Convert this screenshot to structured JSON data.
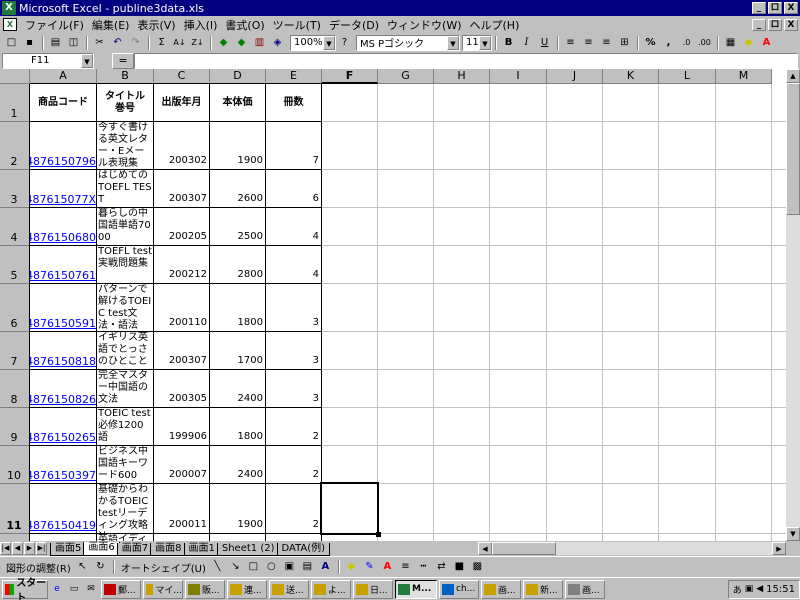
{
  "window": {
    "title": "Microsoft Excel - publine3data.xls",
    "app_icon": "excel-icon",
    "caption_buttons": [
      "_",
      "ロ",
      "X"
    ]
  },
  "menu": {
    "items": [
      "ファイル(F)",
      "編集(E)",
      "表示(V)",
      "挿入(I)",
      "書式(O)",
      "ツール(T)",
      "データ(D)",
      "ウィンドウ(W)",
      "ヘルプ(H)"
    ],
    "doc_buttons": [
      "_",
      "ロ",
      "X"
    ]
  },
  "toolbar": {
    "zoom": "100%",
    "font": "MS Pゴシック",
    "font_size": "11",
    "bold": "B",
    "italic": "I",
    "underline": "U",
    "percent": "%",
    "comma": ","
  },
  "formula_bar": {
    "name_box": "F11",
    "eq": "=",
    "value": ""
  },
  "grid": {
    "columns": [
      "A",
      "B",
      "C",
      "D",
      "E",
      "F",
      "G",
      "H",
      "I",
      "J",
      "K",
      "L",
      "M"
    ],
    "headers": {
      "A": "商品コード",
      "B": "タイトル 巻号",
      "C": "出版年月",
      "D": "本体価",
      "E": "冊数"
    },
    "rows": [
      {
        "n": "2",
        "code": "4876150796",
        "title": "今すぐ書ける英文レター・Eメール表現集",
        "date": "200302",
        "price": "1900",
        "qty": "7"
      },
      {
        "n": "3",
        "code": "487615077X",
        "title": "はじめてのTOEFL TEST",
        "date": "200307",
        "price": "2600",
        "qty": "6"
      },
      {
        "n": "4",
        "code": "4876150680",
        "title": "暮らしの中国語単語7000",
        "date": "200205",
        "price": "2500",
        "qty": "4"
      },
      {
        "n": "5",
        "code": "4876150761",
        "title": "TOEFL test実戦問題集",
        "date": "200212",
        "price": "2800",
        "qty": "4"
      },
      {
        "n": "6",
        "code": "4876150591",
        "title": "パターンで解けるTOEIC test文法・語法",
        "date": "200110",
        "price": "1800",
        "qty": "3"
      },
      {
        "n": "7",
        "code": "4876150818",
        "title": "イギリス英語でとっさのひとこと",
        "date": "200307",
        "price": "1700",
        "qty": "3"
      },
      {
        "n": "8",
        "code": "4876150826",
        "title": "完全マスター中国語の文法",
        "date": "200305",
        "price": "2400",
        "qty": "3"
      },
      {
        "n": "9",
        "code": "4876150265",
        "title": "TOEIC test必修1200語",
        "date": "199906",
        "price": "1800",
        "qty": "2"
      },
      {
        "n": "10",
        "code": "4876150397",
        "title": "ビジネス中国語キーワード600",
        "date": "200007",
        "price": "2400",
        "qty": "2"
      },
      {
        "n": "11",
        "code": "4876150419",
        "title": "基礎からわかるTOEIC testリーディング攻略法",
        "date": "200011",
        "price": "1900",
        "qty": "2"
      }
    ],
    "partial_row_title": "英語イディオム出題ラ"
  },
  "sheet_tabs": [
    "画面5",
    "画面6",
    "画面7",
    "画面8",
    "画面1",
    "Sheet1 (2)",
    "DATA(例)"
  ],
  "active_tab": "画面6",
  "drawing_toolbar": {
    "adjust": "図形の調整(R)",
    "autoshape": "オートシェイプ(U)"
  },
  "taskbar": {
    "start": "スタート",
    "tasks": [
      "郵...",
      "マイ...",
      "販...",
      "連...",
      "送...",
      "よ...",
      "日...",
      "M...",
      "ch...",
      "画...",
      "新...",
      "画..."
    ],
    "active_task_index": 7,
    "clock": "15:51",
    "ime": "あ"
  }
}
